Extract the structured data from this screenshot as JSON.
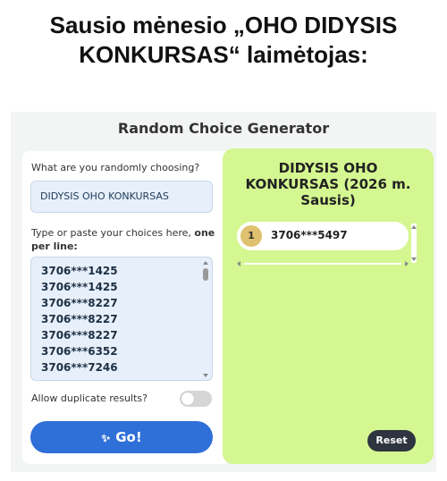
{
  "headline": {
    "line1": "Sausio mėnesio „OHO DIDYSIS",
    "line2": "KONKURSAS“ laimėtojas:"
  },
  "app": {
    "title": "Random Choice Generator",
    "left_panel": {
      "choosing_label": "What are you randomly choosing?",
      "choosing_value": "DIDYSIS OHO KONKURSAS",
      "choices_label_plain": "Type or paste your choices here, ",
      "choices_label_bold": "one per line:",
      "choices": [
        "3706***1425",
        "3706***1425",
        "3706***8227",
        "3706***8227",
        "3706***8227",
        "3706***6352",
        "3706***7246"
      ],
      "duplicate_label": "Allow duplicate results?",
      "duplicate_enabled": false,
      "go_icon": "sparkle-icon",
      "go_label": "Go!"
    },
    "right_panel": {
      "title": "DIDYSIS OHO KONKURSAS (2026 m. Sausis)",
      "results": [
        {
          "rank": "1",
          "value": "3706***5497"
        }
      ],
      "reset_label": "Reset"
    }
  },
  "colors": {
    "accent_blue": "#2f6fd8",
    "result_panel": "#d4f791",
    "rank_badge": "#e0c16f",
    "input_bg": "#e7f0fa",
    "reset_bg": "#2e3540"
  }
}
